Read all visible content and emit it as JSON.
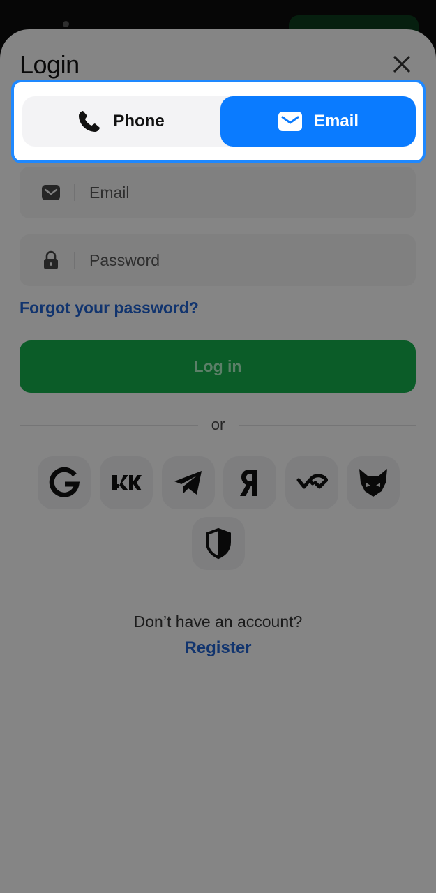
{
  "header": {
    "title": "Login"
  },
  "tabs": [
    {
      "label": "Phone",
      "icon": "phone-icon",
      "selected": false
    },
    {
      "label": "Email",
      "icon": "envelope-icon",
      "selected": true
    }
  ],
  "form": {
    "email": {
      "placeholder": "Email",
      "value": "",
      "icon": "envelope-icon"
    },
    "password": {
      "placeholder": "Password",
      "value": "",
      "icon": "lock-icon"
    },
    "forgot_label": "Forgot your password?",
    "login_label": "Log in"
  },
  "divider": {
    "label": "or"
  },
  "social": [
    {
      "name": "google",
      "icon": "google-icon"
    },
    {
      "name": "vk",
      "icon": "vk-icon"
    },
    {
      "name": "telegram",
      "icon": "telegram-icon"
    },
    {
      "name": "yandex",
      "icon": "yandex-icon"
    },
    {
      "name": "walletconnect",
      "icon": "walletconnect-icon"
    },
    {
      "name": "metamask",
      "icon": "fox-icon"
    },
    {
      "name": "shield",
      "icon": "shield-icon"
    }
  ],
  "footer": {
    "prompt": "Don’t have an account?",
    "register_label": "Register"
  },
  "colors": {
    "accent": "#0a7bff",
    "highlight_border": "#1e88ff",
    "login_green": "#15a84a",
    "link": "#1f5fc9"
  }
}
